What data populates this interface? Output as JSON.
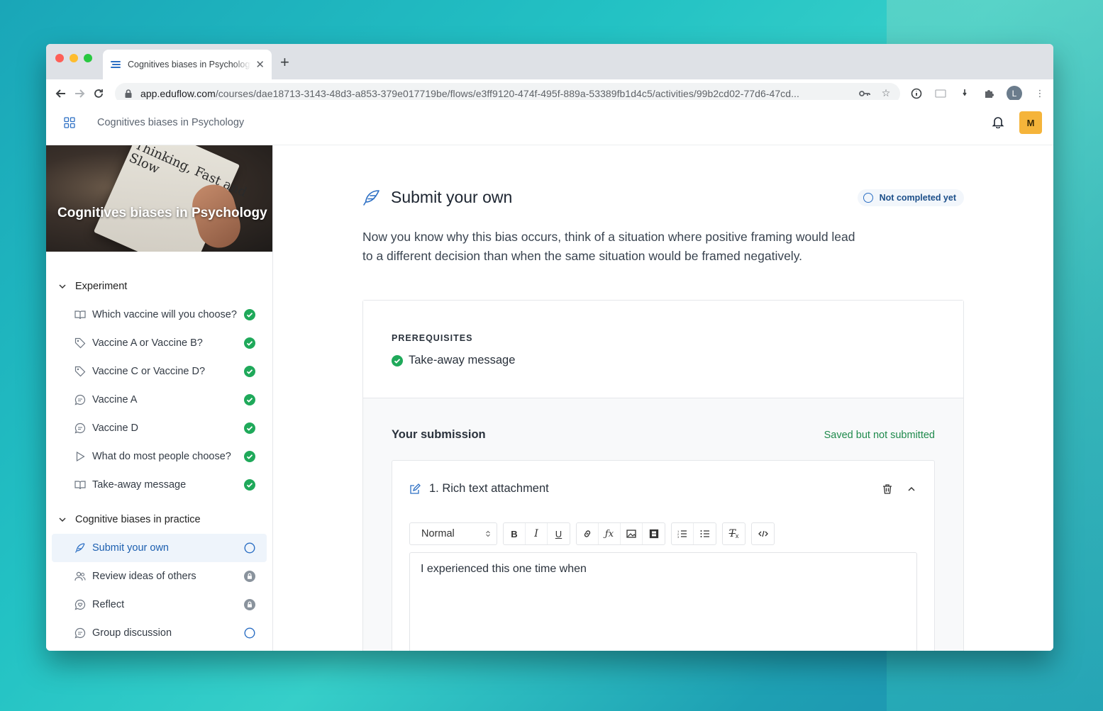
{
  "browser": {
    "tab_title": "Cognitives biases in Psychology | Eduflow",
    "url_domain": "app.eduflow.com",
    "url_path": "/courses/dae18713-3143-48d3-a853-379e017719be/flows/e3ff9120-474f-495f-889a-53389fb1d4c5/activities/99b2cd02-77d6-47cd...",
    "profile_initial": "L"
  },
  "header": {
    "course_title": "Cognitives biases in Psychology",
    "avatar_initial": "M"
  },
  "sidebar": {
    "hero_title": "Cognitives biases in Psychology",
    "hero_book_text": "Thinking, Fast and Slow",
    "sections": [
      {
        "title": "Experiment",
        "items": [
          {
            "label": "Which vaccine will you choose?",
            "icon": "book-icon",
            "status": "completed"
          },
          {
            "label": "Vaccine A or Vaccine B?",
            "icon": "tag-icon",
            "status": "completed"
          },
          {
            "label": "Vaccine C or Vaccine D?",
            "icon": "tag-icon",
            "status": "completed"
          },
          {
            "label": "Vaccine A",
            "icon": "chat-icon",
            "status": "completed"
          },
          {
            "label": "Vaccine D",
            "icon": "chat-icon",
            "status": "completed"
          },
          {
            "label": "What do most people choose?",
            "icon": "play-icon",
            "status": "completed"
          },
          {
            "label": "Take-away message",
            "icon": "book-icon",
            "status": "completed"
          }
        ]
      },
      {
        "title": "Cognitive biases in practice",
        "items": [
          {
            "label": "Submit your own",
            "icon": "feather-icon",
            "status": "not-started",
            "active": true
          },
          {
            "label": "Review ideas of others",
            "icon": "users-icon",
            "status": "locked"
          },
          {
            "label": "Reflect",
            "icon": "heart-chat-icon",
            "status": "locked"
          },
          {
            "label": "Group discussion",
            "icon": "chat-icon",
            "status": "not-started"
          }
        ]
      }
    ]
  },
  "activity": {
    "title": "Submit your own",
    "status_badge": "Not completed yet",
    "description": "Now you know why this bias occurs, think of a situation where positive framing would lead to a different decision than when the same situation would be framed negatively.",
    "prerequisites_label": "PREREQUISITES",
    "prerequisite_item": "Take-away message",
    "submission_title": "Your submission",
    "submission_status": "Saved but not submitted",
    "attachment_title": "1. Rich text attachment",
    "format_select_value": "Normal",
    "editor_text": "I experienced this one time when"
  },
  "colors": {
    "accent": "#2c6fc4",
    "completed": "#1fa95a",
    "locked": "#8a939d",
    "avatar": "#f5b43a"
  }
}
